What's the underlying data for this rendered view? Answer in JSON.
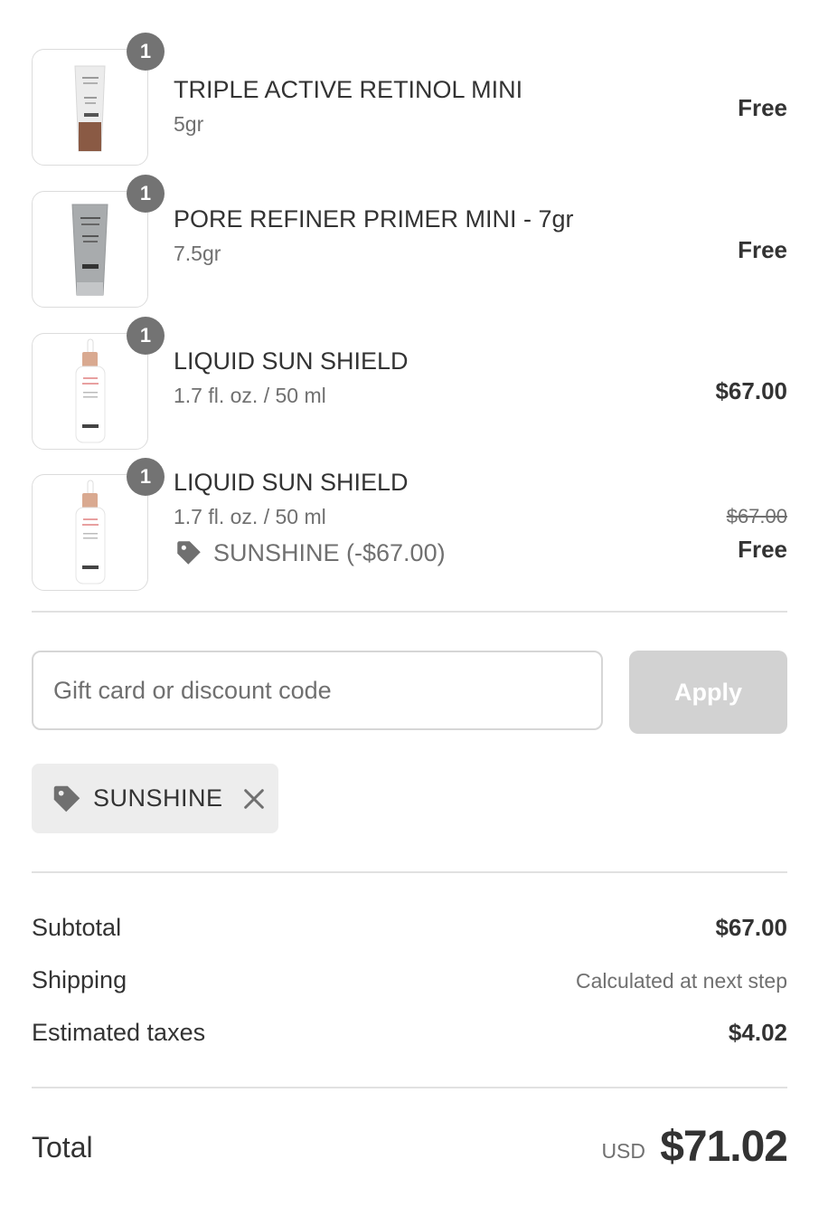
{
  "items": [
    {
      "name": "TRIPLE ACTIVE RETINOL MINI",
      "variant": "5gr",
      "quantity": "1",
      "price": "Free",
      "image_icon": "retinol-tube-image"
    },
    {
      "name": "PORE REFINER PRIMER MINI - 7gr",
      "variant": "7.5gr",
      "quantity": "1",
      "price": "Free",
      "image_icon": "primer-tube-image"
    },
    {
      "name": "LIQUID SUN SHIELD",
      "variant": "1.7 fl. oz. / 50 ml",
      "quantity": "1",
      "price": "$67.00",
      "image_icon": "dropper-bottle-image"
    },
    {
      "name": "LIQUID SUN SHIELD",
      "variant": "1.7 fl. oz. / 50 ml",
      "quantity": "1",
      "discount": "SUNSHINE (-$67.00)",
      "original_price": "$67.00",
      "price": "Free",
      "image_icon": "dropper-bottle-image"
    }
  ],
  "discount_form": {
    "placeholder": "Gift card or discount code",
    "apply_label": "Apply"
  },
  "applied_code": {
    "label": "SUNSHINE",
    "icon": "tag-icon",
    "remove_icon": "close-icon"
  },
  "summary": {
    "subtotal_label": "Subtotal",
    "subtotal_value": "$67.00",
    "shipping_label": "Shipping",
    "shipping_value": "Calculated at next step",
    "taxes_label": "Estimated taxes",
    "taxes_value": "$4.02"
  },
  "total": {
    "label": "Total",
    "currency": "USD",
    "amount": "$71.02"
  },
  "colors": {
    "badge": "#737373",
    "apply_disabled": "#d2d2d2",
    "chip_bg": "#ededed",
    "divider": "#e1e1e1"
  }
}
